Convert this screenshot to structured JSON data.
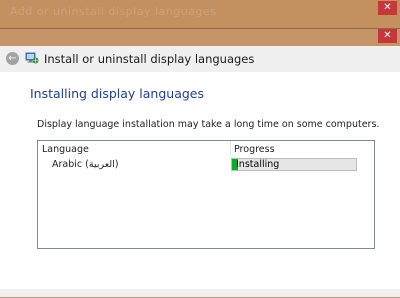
{
  "background_window": {
    "title": "Add or uninstall display languages",
    "close_glyph": "✕"
  },
  "dialog": {
    "close_glyph": "✕",
    "back_glyph": "←",
    "back_icon": "back-arrow-icon",
    "app_icon": "language-settings-icon",
    "header_title": "Install or uninstall display languages"
  },
  "content": {
    "heading": "Installing display languages",
    "description": "Display language installation may take a long time on some computers.",
    "columns": {
      "language": "Language",
      "progress": "Progress"
    },
    "rows": [
      {
        "language": "Arabic (العربية)",
        "status": "Installing",
        "progress": 0.05
      }
    ]
  },
  "colors": {
    "heading": "#1f3f9b",
    "progress_fill": "#06b025",
    "close_button": "#c7373a",
    "frame": "#c59467"
  }
}
